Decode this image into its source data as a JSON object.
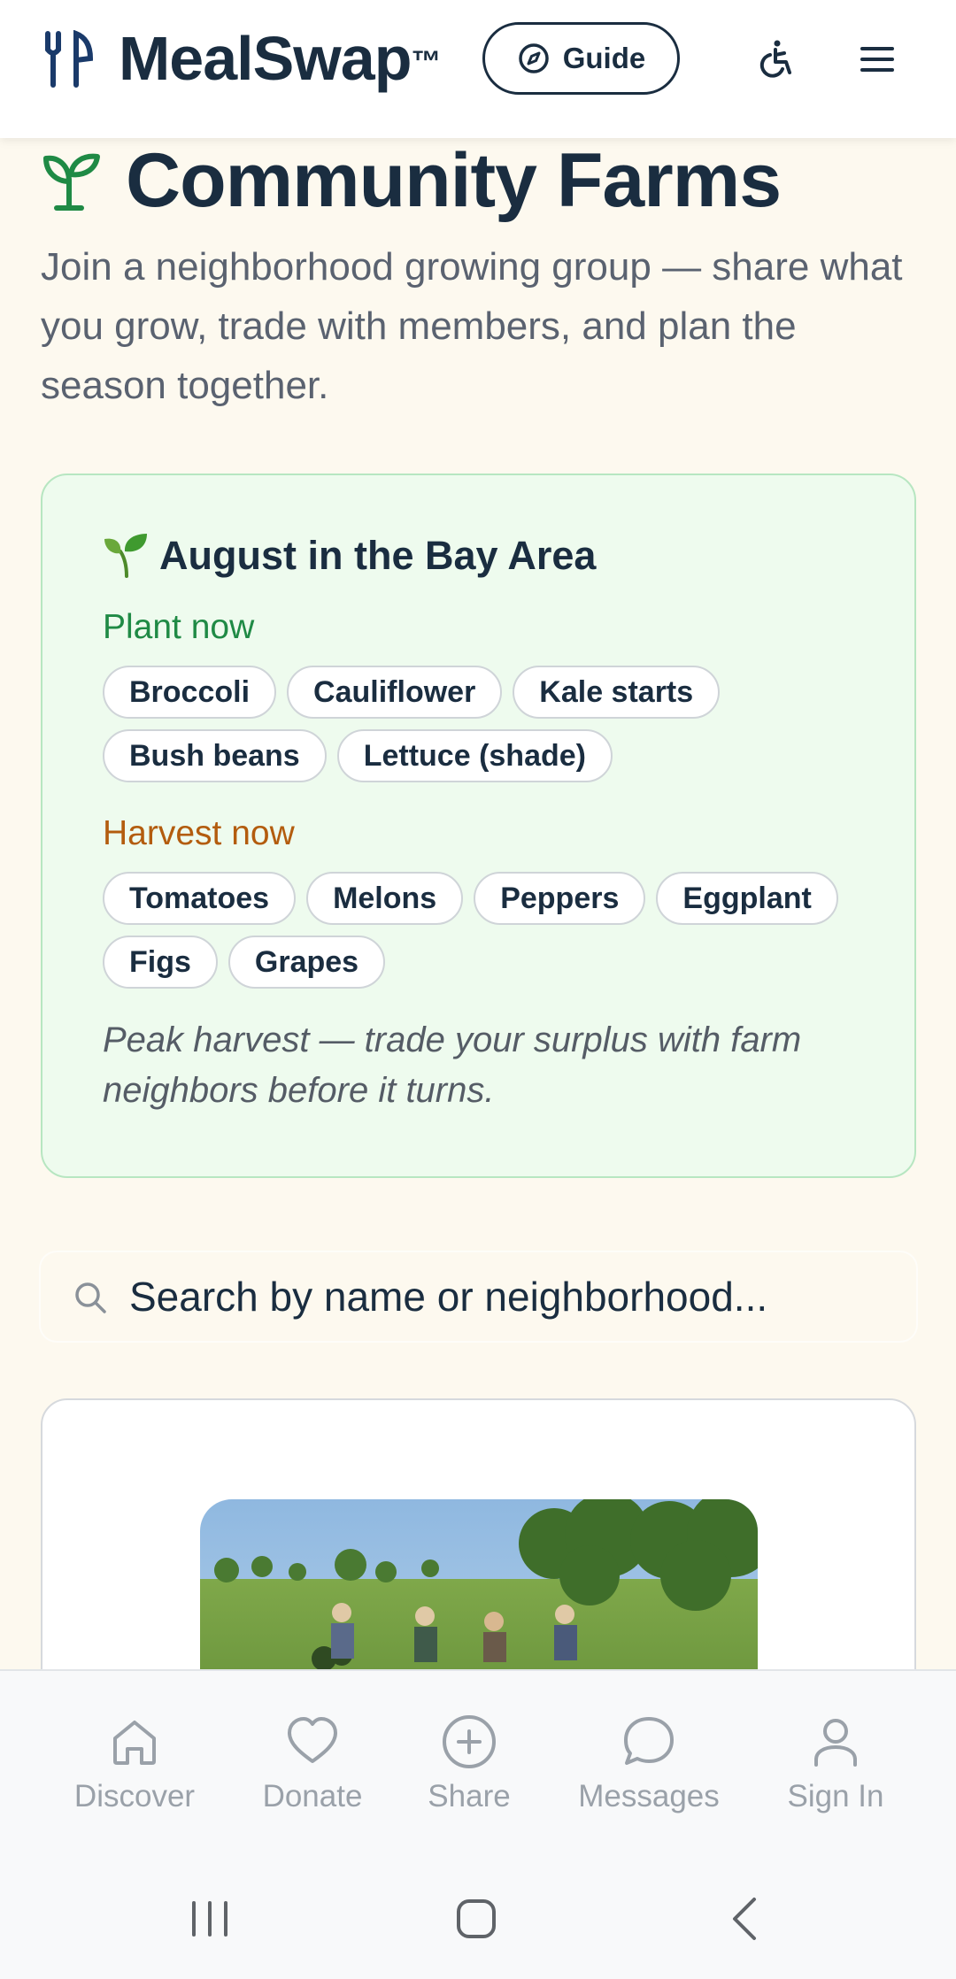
{
  "header": {
    "brand": "MealSwap",
    "brand_mark": "™",
    "guide_label": "Guide",
    "icons": [
      "fork-knife-icon",
      "compass-icon",
      "accessibility-icon",
      "hamburger-menu-icon"
    ]
  },
  "page": {
    "title": "Community Farms",
    "subtitle": "Join a neighborhood growing group — share what you grow, trade with members, and plan the season together."
  },
  "season": {
    "title": "August in the Bay Area",
    "plant_label": "Plant now",
    "plant_items": [
      "Broccoli",
      "Cauliflower",
      "Kale starts",
      "Bush beans",
      "Lettuce (shade)"
    ],
    "harvest_label": "Harvest now",
    "harvest_items": [
      "Tomatoes",
      "Melons",
      "Peppers",
      "Eggplant",
      "Figs",
      "Grapes"
    ],
    "note": "Peak harvest — trade your surplus with farm neighbors before it turns."
  },
  "search": {
    "placeholder": "Search by name or neighborhood..."
  },
  "bottom_nav": {
    "items": [
      {
        "label": "Discover",
        "icon": "home-icon"
      },
      {
        "label": "Donate",
        "icon": "heart-icon"
      },
      {
        "label": "Share",
        "icon": "plus-circle-icon"
      },
      {
        "label": "Messages",
        "icon": "chat-bubble-icon"
      },
      {
        "label": "Sign In",
        "icon": "user-icon"
      }
    ]
  },
  "colors": {
    "navy": "#1a2d40",
    "green": "#1f8a45",
    "orange": "#b35c0e",
    "background": "#fdf9ef",
    "card_green": "#eefbee"
  }
}
